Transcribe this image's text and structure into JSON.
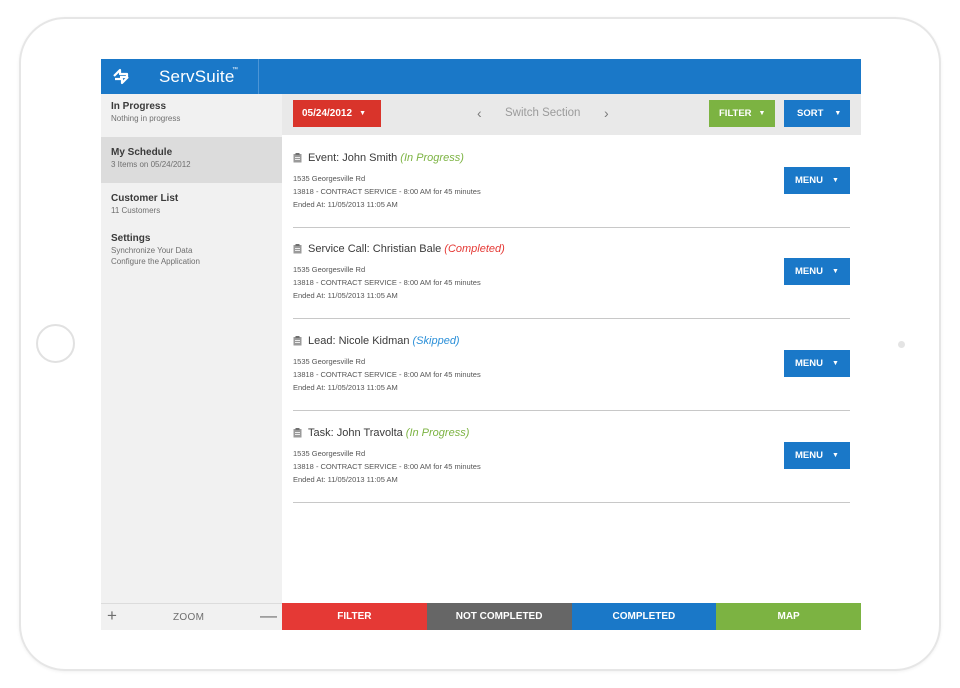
{
  "app": {
    "name": "ServSuite",
    "trademark": "™"
  },
  "colors": {
    "brand_blue": "#1a78c8",
    "red": "#d9342b",
    "green": "#7cb342",
    "gray_tab": "#666666"
  },
  "sidebar": {
    "items": [
      {
        "title": "In Progress",
        "sub1": "Nothing in progress",
        "sub2": ""
      },
      {
        "title": "My Schedule",
        "sub1": "3 Items on 05/24/2012",
        "sub2": ""
      },
      {
        "title": "Customer List",
        "sub1": "11 Customers",
        "sub2": ""
      },
      {
        "title": "Settings",
        "sub1": "Synchronize Your Data",
        "sub2": "Configure the Application"
      }
    ],
    "active_index": 1,
    "footer": {
      "plus": "+",
      "label": "ZOOM",
      "minus": "—"
    }
  },
  "toolbar": {
    "date_label": "05/24/2012",
    "caret": "▼",
    "switch_prev": "‹",
    "switch_label": "Switch Section",
    "switch_next": "›",
    "filter_label": "FILTER",
    "sort_label": "SORT"
  },
  "entries": [
    {
      "title": "Event: John Smith",
      "status": "(In Progress)",
      "status_color": "#7cb342",
      "address": "1535 Georgesville Rd",
      "service": "13818 - CONTRACT SERVICE - 8:00 AM for 45 minutes",
      "ended": "Ended At: 11/05/2013 11:05 AM",
      "menu_label": "MENU"
    },
    {
      "title": "Service Call: Christian Bale",
      "status": "(Completed)",
      "status_color": "#e53935",
      "address": "1535 Georgesville Rd",
      "service": "13818 - CONTRACT SERVICE - 8:00 AM for 45 minutes",
      "ended": "Ended At: 11/05/2013 11:05 AM",
      "menu_label": "MENU"
    },
    {
      "title": "Lead: Nicole Kidman",
      "status": "(Skipped)",
      "status_color": "#2a8fd8",
      "address": "1535 Georgesville Rd",
      "service": "13818 - CONTRACT SERVICE - 8:00 AM for 45 minutes",
      "ended": "Ended At: 11/05/2013 11:05 AM",
      "menu_label": "MENU"
    },
    {
      "title": "Task: John Travolta",
      "status": "(In Progress)",
      "status_color": "#7cb342",
      "address": "1535 Georgesville Rd",
      "service": "13818 - CONTRACT SERVICE - 8:00 AM for 45 minutes",
      "ended": "Ended At: 11/05/2013 11:05 AM",
      "menu_label": "MENU"
    }
  ],
  "bottom_tabs": [
    {
      "label": "FILTER",
      "color": "#e53935"
    },
    {
      "label": "NOT COMPLETED",
      "color": "#666666"
    },
    {
      "label": "COMPLETED",
      "color": "#1a78c8"
    },
    {
      "label": "MAP",
      "color": "#7cb342"
    }
  ]
}
